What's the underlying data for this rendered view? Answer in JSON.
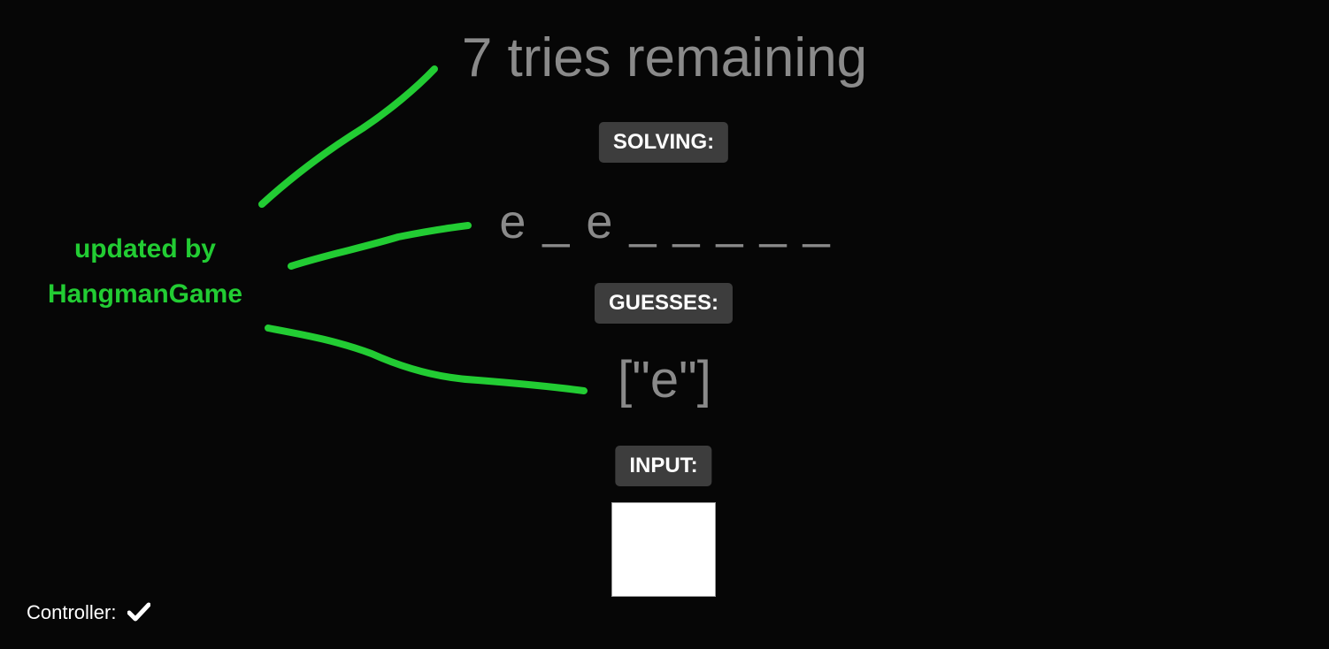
{
  "game": {
    "tries_text": "7 tries remaining",
    "solving_label": "SOLVING:",
    "solving_word": "e _ e _ _ _ _ _",
    "guesses_label": "GUESSES:",
    "guesses_value": "[\"e\"]",
    "input_label": "INPUT:",
    "input_value": ""
  },
  "footer": {
    "controller_label": "Controller:",
    "controller_icon": "checkmark-icon"
  },
  "annotation": {
    "line1": "updated by",
    "line2": "HangmanGame",
    "color": "#22cc33"
  },
  "colors": {
    "background": "#060606",
    "muted_text": "#8a8a8a",
    "badge_bg": "#3d3d3d"
  }
}
